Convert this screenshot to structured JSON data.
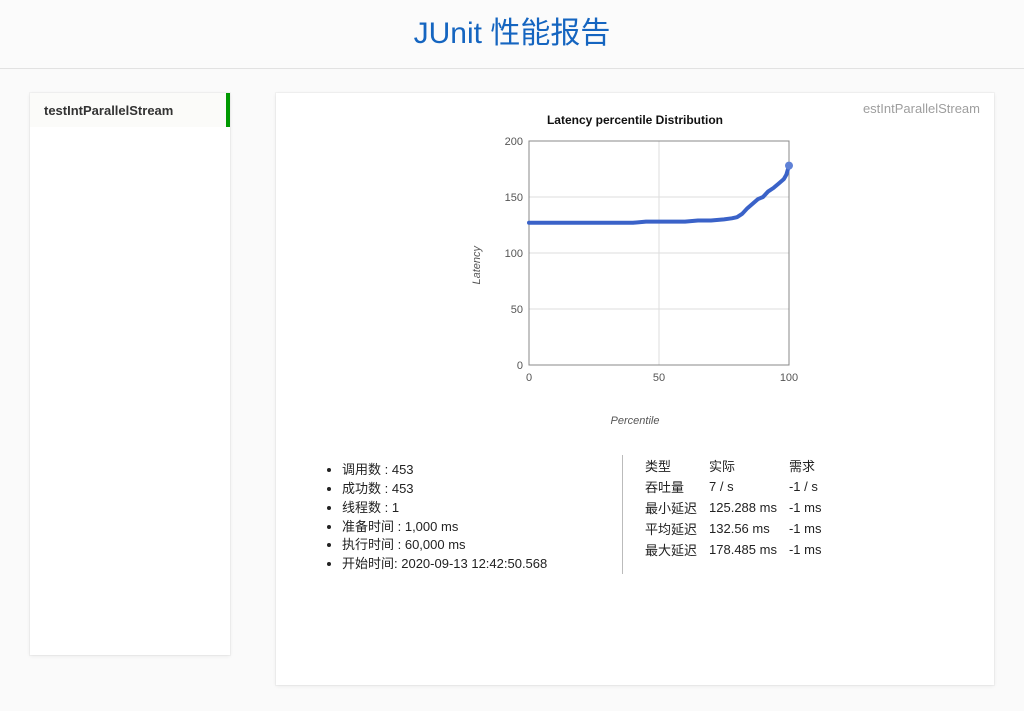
{
  "header": {
    "title_en": "JUnit",
    "title_cn": " 性能报告"
  },
  "sidebar": {
    "items": [
      {
        "label": "testIntParallelStream"
      }
    ]
  },
  "crumb": {
    "text": "estIntParallelStream"
  },
  "chart": {
    "title": "Latency percentile Distribution",
    "xlabel": "Percentile",
    "ylabel": "Latency"
  },
  "chart_data": {
    "type": "line",
    "title": "Latency percentile Distribution",
    "xlabel": "Percentile",
    "ylabel": "Latency",
    "xlim": [
      0,
      100
    ],
    "ylim": [
      0,
      200
    ],
    "x_ticks": [
      0,
      50,
      100
    ],
    "y_ticks": [
      0,
      50,
      100,
      150,
      200
    ],
    "x": [
      0,
      5,
      10,
      15,
      20,
      25,
      30,
      35,
      40,
      45,
      50,
      55,
      60,
      65,
      70,
      75,
      78,
      80,
      82,
      84,
      86,
      88,
      90,
      92,
      94,
      96,
      98,
      99,
      100
    ],
    "values": [
      127,
      127,
      127,
      127,
      127,
      127,
      127,
      127,
      127,
      128,
      128,
      128,
      128,
      129,
      129,
      130,
      131,
      132,
      135,
      140,
      144,
      148,
      150,
      155,
      158,
      162,
      166,
      170,
      178
    ]
  },
  "stats_left": [
    {
      "label": "调用数 : ",
      "value": "453"
    },
    {
      "label": "成功数 : ",
      "value": "453"
    },
    {
      "label": "线程数 : ",
      "value": "1"
    },
    {
      "label": "准备时间 : ",
      "value": "1,000 ms"
    },
    {
      "label": "执行时间 : ",
      "value": "60,000 ms"
    },
    {
      "label": "开始时间: ",
      "value": "2020-09-13 12:42:50.568"
    }
  ],
  "stats_right": {
    "head": {
      "col0": "类型",
      "col1": "实际",
      "col2": "需求"
    },
    "rows": [
      {
        "label": "吞吐量",
        "actual": "7 / s",
        "required": "-1 / s"
      },
      {
        "label": "最小延迟",
        "actual": "125.288 ms",
        "required": "-1 ms"
      },
      {
        "label": "平均延迟",
        "actual": "132.56 ms",
        "required": "-1 ms"
      },
      {
        "label": "最大延迟",
        "actual": "178.485 ms",
        "required": "-1 ms"
      }
    ]
  }
}
